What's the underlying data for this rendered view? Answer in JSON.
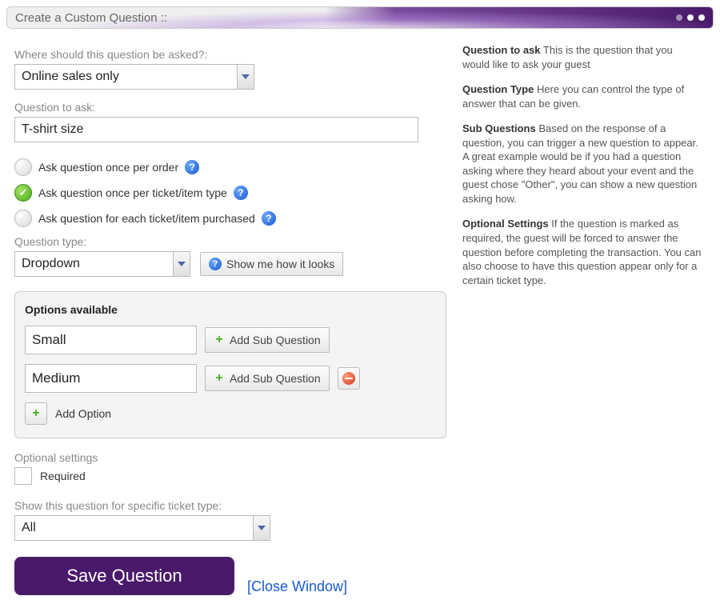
{
  "header": {
    "title": "Create a Custom Question ::"
  },
  "where": {
    "label": "Where should this question be asked?:",
    "value": "Online sales only"
  },
  "question": {
    "label": "Question to ask:",
    "value": "T-shirt size"
  },
  "ask_mode": {
    "options": [
      {
        "label": "Ask question once per order",
        "selected": false
      },
      {
        "label": "Ask question once per ticket/item type",
        "selected": true
      },
      {
        "label": "Ask question for each ticket/item purchased",
        "selected": false
      }
    ]
  },
  "qtype": {
    "label": "Question type:",
    "value": "Dropdown",
    "show_me": "Show me how it looks"
  },
  "options_panel": {
    "title": "Options available",
    "rows": [
      {
        "value": "Small",
        "add_sub": "Add Sub Question",
        "removable": false
      },
      {
        "value": "Medium",
        "add_sub": "Add Sub Question",
        "removable": true
      }
    ],
    "add_option": "Add Option"
  },
  "optional": {
    "label": "Optional settings",
    "required_label": "Required",
    "required_checked": false
  },
  "specific": {
    "label": "Show this question for specific ticket type:",
    "value": "All"
  },
  "footer": {
    "save": "Save Question",
    "close": "[Close Window]"
  },
  "help": {
    "p1_bold": "Question to ask",
    "p1": " This is the question that you would like to ask your guest",
    "p2_bold": "Question Type",
    "p2": " Here you can control the type of answer that can be given.",
    "p3_bold": "Sub Questions",
    "p3": " Based on the response of a question, you can trigger a new question to appear. A great example would be if you had a question asking where they heard about your event and the guest chose \"Other\", you can show a new question asking how.",
    "p4_bold": "Optional Settings",
    "p4": " If the question is marked as required, the guest will be forced to answer the question before completing the transaction. You can also choose to have this question appear only for a certain ticket type."
  }
}
